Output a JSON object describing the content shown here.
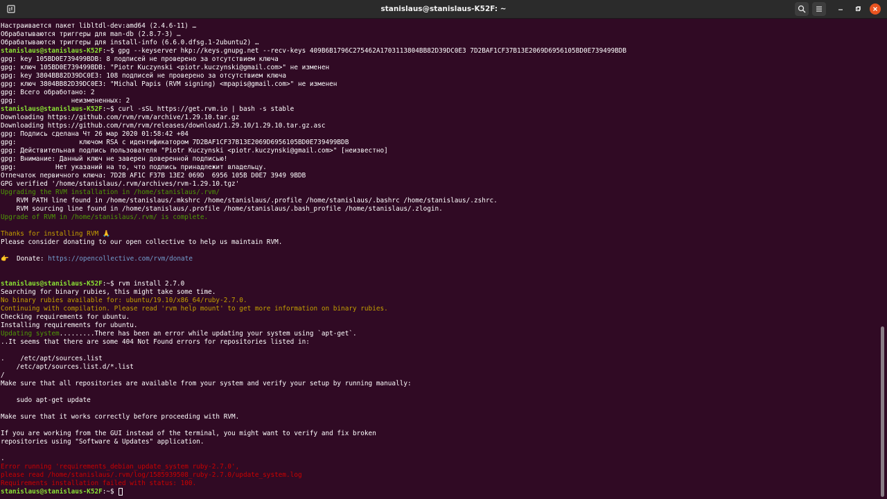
{
  "window": {
    "title": "stanislaus@stanislaus-K52F: ~"
  },
  "icons": {
    "new_tab": "new-tab-icon",
    "search": "search-icon",
    "menu": "hamburger-menu-icon",
    "minimize": "minimize-icon",
    "maximize": "maximize-icon",
    "close": "close-icon"
  },
  "colors": {
    "background": "#300a24",
    "prompt": "#8ae234",
    "info_green": "#4e9a06",
    "warning_yellow": "#c4a000",
    "error_red": "#cc0000",
    "link_blue": "#729fcf",
    "close_button": "#e95420"
  },
  "terminal": {
    "prompt_user": "stanislaus@stanislaus-K52F",
    "prompt_path": ":~$ ",
    "lines": [
      {
        "text": "Настраивается пакет libltdl-dev:amd64 (2.4.6-11) …",
        "style": "plain"
      },
      {
        "text": "Обрабатываются триггеры для man-db (2.8.7-3) …",
        "style": "plain"
      },
      {
        "text": "Обрабатываются триггеры для install-info (6.6.0.dfsg.1-2ubuntu2) …",
        "style": "plain"
      },
      {
        "command": "gpg --keyserver hkp://keys.gnupg.net --recv-keys 409B6B1796C275462A1703113804BB82D39DC0E3 7D2BAF1CF37B13E2069D6956105BD0E739499BDB"
      },
      {
        "text": "gpg: key 105BD0E739499BDB: 8 подписей не проверено за отсутствием ключа",
        "style": "plain"
      },
      {
        "text": "gpg: ключ 105BD0E739499BDB: \"Piotr Kuczynski <piotr.kuczynski@gmail.com>\" не изменен",
        "style": "plain"
      },
      {
        "text": "gpg: key 3804BB82D39DC0E3: 108 подписей не проверено за отсутствием ключа",
        "style": "plain"
      },
      {
        "text": "gpg: ключ 3804BB82D39DC0E3: \"Michal Papis (RVM signing) <mpapis@gmail.com>\" не изменен",
        "style": "plain"
      },
      {
        "text": "gpg: Всего обработано: 2",
        "style": "plain"
      },
      {
        "text": "gpg:              неизмененных: 2",
        "style": "plain"
      },
      {
        "command": "curl -sSL https://get.rvm.io | bash -s stable"
      },
      {
        "text": "Downloading https://github.com/rvm/rvm/archive/1.29.10.tar.gz",
        "style": "plain"
      },
      {
        "text": "Downloading https://github.com/rvm/rvm/releases/download/1.29.10/1.29.10.tar.gz.asc",
        "style": "plain"
      },
      {
        "text": "gpg: Подпись сделана Чт 26 мар 2020 01:58:42 +04",
        "style": "plain"
      },
      {
        "text": "gpg:                ключом RSA с идентификатором 7D2BAF1CF37B13E2069D6956105BD0E739499BDB",
        "style": "plain"
      },
      {
        "text": "gpg: Действительная подпись пользователя \"Piotr Kuczynski <piotr.kuczynski@gmail.com>\" [неизвестно]",
        "style": "plain"
      },
      {
        "text": "gpg: Внимание: Данный ключ не заверен доверенной подписью!",
        "style": "plain"
      },
      {
        "text": "gpg:          Нет указаний на то, что подпись принадлежит владельцу.",
        "style": "plain"
      },
      {
        "text": "Отпечаток первичного ключа: 7D2B AF1C F37B 13E2 069D  6956 105B D0E7 3949 9BDB",
        "style": "plain"
      },
      {
        "text": "GPG verified '/home/stanislaus/.rvm/archives/rvm-1.29.10.tgz'",
        "style": "plain"
      },
      {
        "text": "Upgrading the RVM installation in /home/stanislaus/.rvm/",
        "style": "green"
      },
      {
        "text": "    RVM PATH line found in /home/stanislaus/.mkshrc /home/stanislaus/.profile /home/stanislaus/.bashrc /home/stanislaus/.zshrc.",
        "style": "plain"
      },
      {
        "text": "    RVM sourcing line found in /home/stanislaus/.profile /home/stanislaus/.bash_profile /home/stanislaus/.zlogin.",
        "style": "plain"
      },
      {
        "text": "Upgrade of RVM in /home/stanislaus/.rvm/ is complete.",
        "style": "green"
      },
      {
        "text": "",
        "style": "plain"
      },
      {
        "text": "Thanks for installing RVM 🙏",
        "style": "yellow"
      },
      {
        "text": "Please consider donating to our open collective to help us maintain RVM.",
        "style": "plain"
      },
      {
        "text": "",
        "style": "plain"
      },
      {
        "donate": true,
        "label": "👉  Donate: ",
        "url": "https://opencollective.com/rvm/donate"
      },
      {
        "text": "",
        "style": "plain"
      },
      {
        "text": "",
        "style": "plain"
      },
      {
        "command": "rvm install 2.7.0"
      },
      {
        "text": "Searching for binary rubies, this might take some time.",
        "style": "plain"
      },
      {
        "text": "No binary rubies available for: ubuntu/19.10/x86_64/ruby-2.7.0.",
        "style": "yellow"
      },
      {
        "text": "Continuing with compilation. Please read 'rvm help mount' to get more information on binary rubies.",
        "style": "yellow"
      },
      {
        "text": "Checking requirements for ubuntu.",
        "style": "plain"
      },
      {
        "text": "Installing requirements for ubuntu.",
        "style": "plain"
      },
      {
        "mixed": true,
        "green_part": "Updating system",
        "rest": ".........There has been an error while updating your system using `apt-get`."
      },
      {
        "text": "..It seems that there are some 404 Not Found errors for repositories listed in:",
        "style": "plain"
      },
      {
        "text": "",
        "style": "plain"
      },
      {
        "text": ".    /etc/apt/sources.list",
        "style": "plain"
      },
      {
        "text": "    /etc/apt/sources.list.d/*.list",
        "style": "plain"
      },
      {
        "text": "/",
        "style": "plain"
      },
      {
        "text": "Make sure that all repositories are available from your system and verify your setup by running manually:",
        "style": "plain"
      },
      {
        "text": "",
        "style": "plain"
      },
      {
        "text": "    sudo apt-get update",
        "style": "plain"
      },
      {
        "text": "",
        "style": "plain"
      },
      {
        "text": "Make sure that it works correctly before proceeding with RVM.",
        "style": "plain"
      },
      {
        "text": "",
        "style": "plain"
      },
      {
        "text": "If you are working from the GUI instead of the terminal, you might want to verify and fix broken",
        "style": "plain"
      },
      {
        "text": "repositories using \"Software & Updates\" application.",
        "style": "plain"
      },
      {
        "text": "",
        "style": "plain"
      },
      {
        "text": ".",
        "style": "plain"
      },
      {
        "text": "Error running 'requirements_debian_update_system ruby-2.7.0',",
        "style": "red"
      },
      {
        "text": "please read /home/stanislaus/.rvm/log/1585939508_ruby-2.7.0/update_system.log",
        "style": "red"
      },
      {
        "text": "Requirements installation failed with status: 100.",
        "style": "red"
      },
      {
        "command": "",
        "cursor": true
      }
    ]
  }
}
